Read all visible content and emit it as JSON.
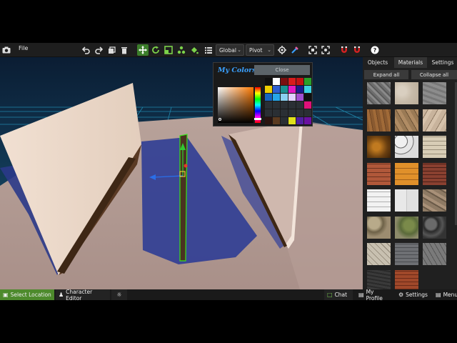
{
  "toolbar": {
    "file_label": "File",
    "space_select": "Global",
    "pivot_select": "Pivot",
    "icons": [
      "camera-icon",
      "undo-icon",
      "redo-icon",
      "duplicate-icon",
      "delete-icon",
      "move-icon",
      "rotate-icon",
      "scale-icon",
      "snap-icon",
      "paint-icon",
      "list-icon",
      "settings-gizmo-icon",
      "eyedropper-icon",
      "frame-icon",
      "focus-icon",
      "magnet-icon",
      "magnet-alt-icon",
      "help-icon"
    ]
  },
  "color_picker": {
    "title": "My Colors",
    "close_label": "Close",
    "swatches": [
      "#111111",
      "#ffffff",
      "#7a0f0f",
      "#d81b1b",
      "#c21212",
      "#2aa02a",
      "#f0d000",
      "#2f5fd0",
      "#1a9090",
      "#e01ac0",
      "#1a1a8c",
      "#3bd1e0",
      "#1565c0",
      "#26a6e8",
      "#8ad0f0",
      "#e0d0ff",
      "#a050d0",
      "#101010",
      "#2a2f34",
      "#2a2f34",
      "#2a2f34",
      "#2a2f34",
      "#2a2f34",
      "#e0107a",
      "#2a2f34",
      "#2a2f34",
      "#2a2f34",
      "#2a2f34",
      "#2a2f34",
      "#2a2f34",
      "#2a1410",
      "#5a3a20",
      "#2a2f34",
      "#e0e01a",
      "#5020a0",
      "#6a10a0"
    ],
    "accent": "#3aa0ff"
  },
  "right_panel": {
    "tabs": [
      {
        "label": "Objects",
        "active": false
      },
      {
        "label": "Materials",
        "active": true
      },
      {
        "label": "Settings",
        "active": false
      }
    ],
    "expand_label": "Expand all",
    "collapse_label": "Collapse all",
    "materials": [
      "granite-grey",
      "sand-stone",
      "concrete-grey",
      "wood-plank",
      "cracked-mud",
      "cracked-clay",
      "amber-rock",
      "white-hex-tiles",
      "beige-bricks",
      "red-bricks",
      "orange-tiles",
      "dark-red-bricks",
      "white-wall-tiles",
      "white-panels",
      "stone-wall",
      "cobble-mix",
      "mossy-stones",
      "round-pebbles",
      "flagstone",
      "grey-cobble",
      "slate-tiles",
      "dark-asphalt",
      "terracotta-tiles"
    ]
  },
  "bottom_bar": {
    "select_location": "Select Location",
    "character_editor": "Character Editor",
    "chat": "Chat",
    "my_profile": "My Profile",
    "settings": "Settings",
    "menu": "Menu"
  }
}
